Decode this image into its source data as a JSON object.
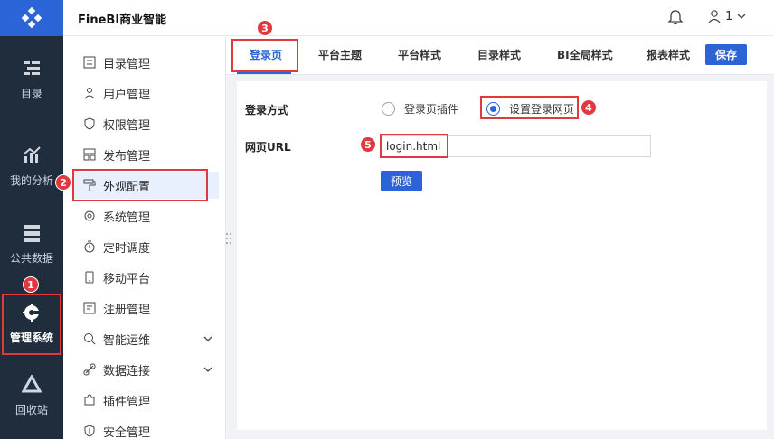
{
  "app": {
    "title": "FineBI商业智能"
  },
  "header": {
    "user_count": "1"
  },
  "leftnav": {
    "items": [
      {
        "label": "目录",
        "icon": "catalog-icon"
      },
      {
        "label": "我的分析",
        "icon": "analysis-icon"
      },
      {
        "label": "公共数据",
        "icon": "data-icon"
      },
      {
        "label": "管理系统",
        "icon": "gear-icon"
      },
      {
        "label": "回收站",
        "icon": "recycle-icon"
      }
    ]
  },
  "submenu": {
    "items": [
      {
        "label": "目录管理"
      },
      {
        "label": "用户管理"
      },
      {
        "label": "权限管理"
      },
      {
        "label": "发布管理"
      },
      {
        "label": "外观配置"
      },
      {
        "label": "系统管理"
      },
      {
        "label": "定时调度"
      },
      {
        "label": "移动平台"
      },
      {
        "label": "注册管理"
      },
      {
        "label": "智能运维"
      },
      {
        "label": "数据连接"
      },
      {
        "label": "插件管理"
      },
      {
        "label": "安全管理"
      }
    ]
  },
  "tabs": [
    {
      "label": "登录页"
    },
    {
      "label": "平台主题"
    },
    {
      "label": "平台样式"
    },
    {
      "label": "目录样式"
    },
    {
      "label": "BI全局样式"
    },
    {
      "label": "报表样式"
    }
  ],
  "toolbar": {
    "save_label": "保存"
  },
  "form": {
    "login_method_label": "登录方式",
    "option_plugin": "登录页插件",
    "option_custom": "设置登录网页",
    "url_label": "网页URL",
    "url_value": "login.html",
    "preview_label": "预览"
  },
  "annotations": {
    "b1": "1",
    "b2": "2",
    "b3": "3",
    "b4": "4",
    "b5": "5"
  },
  "colors": {
    "accent": "#2b64d7",
    "nav_bg": "#1f2d3d",
    "highlight": "#e0393e"
  }
}
